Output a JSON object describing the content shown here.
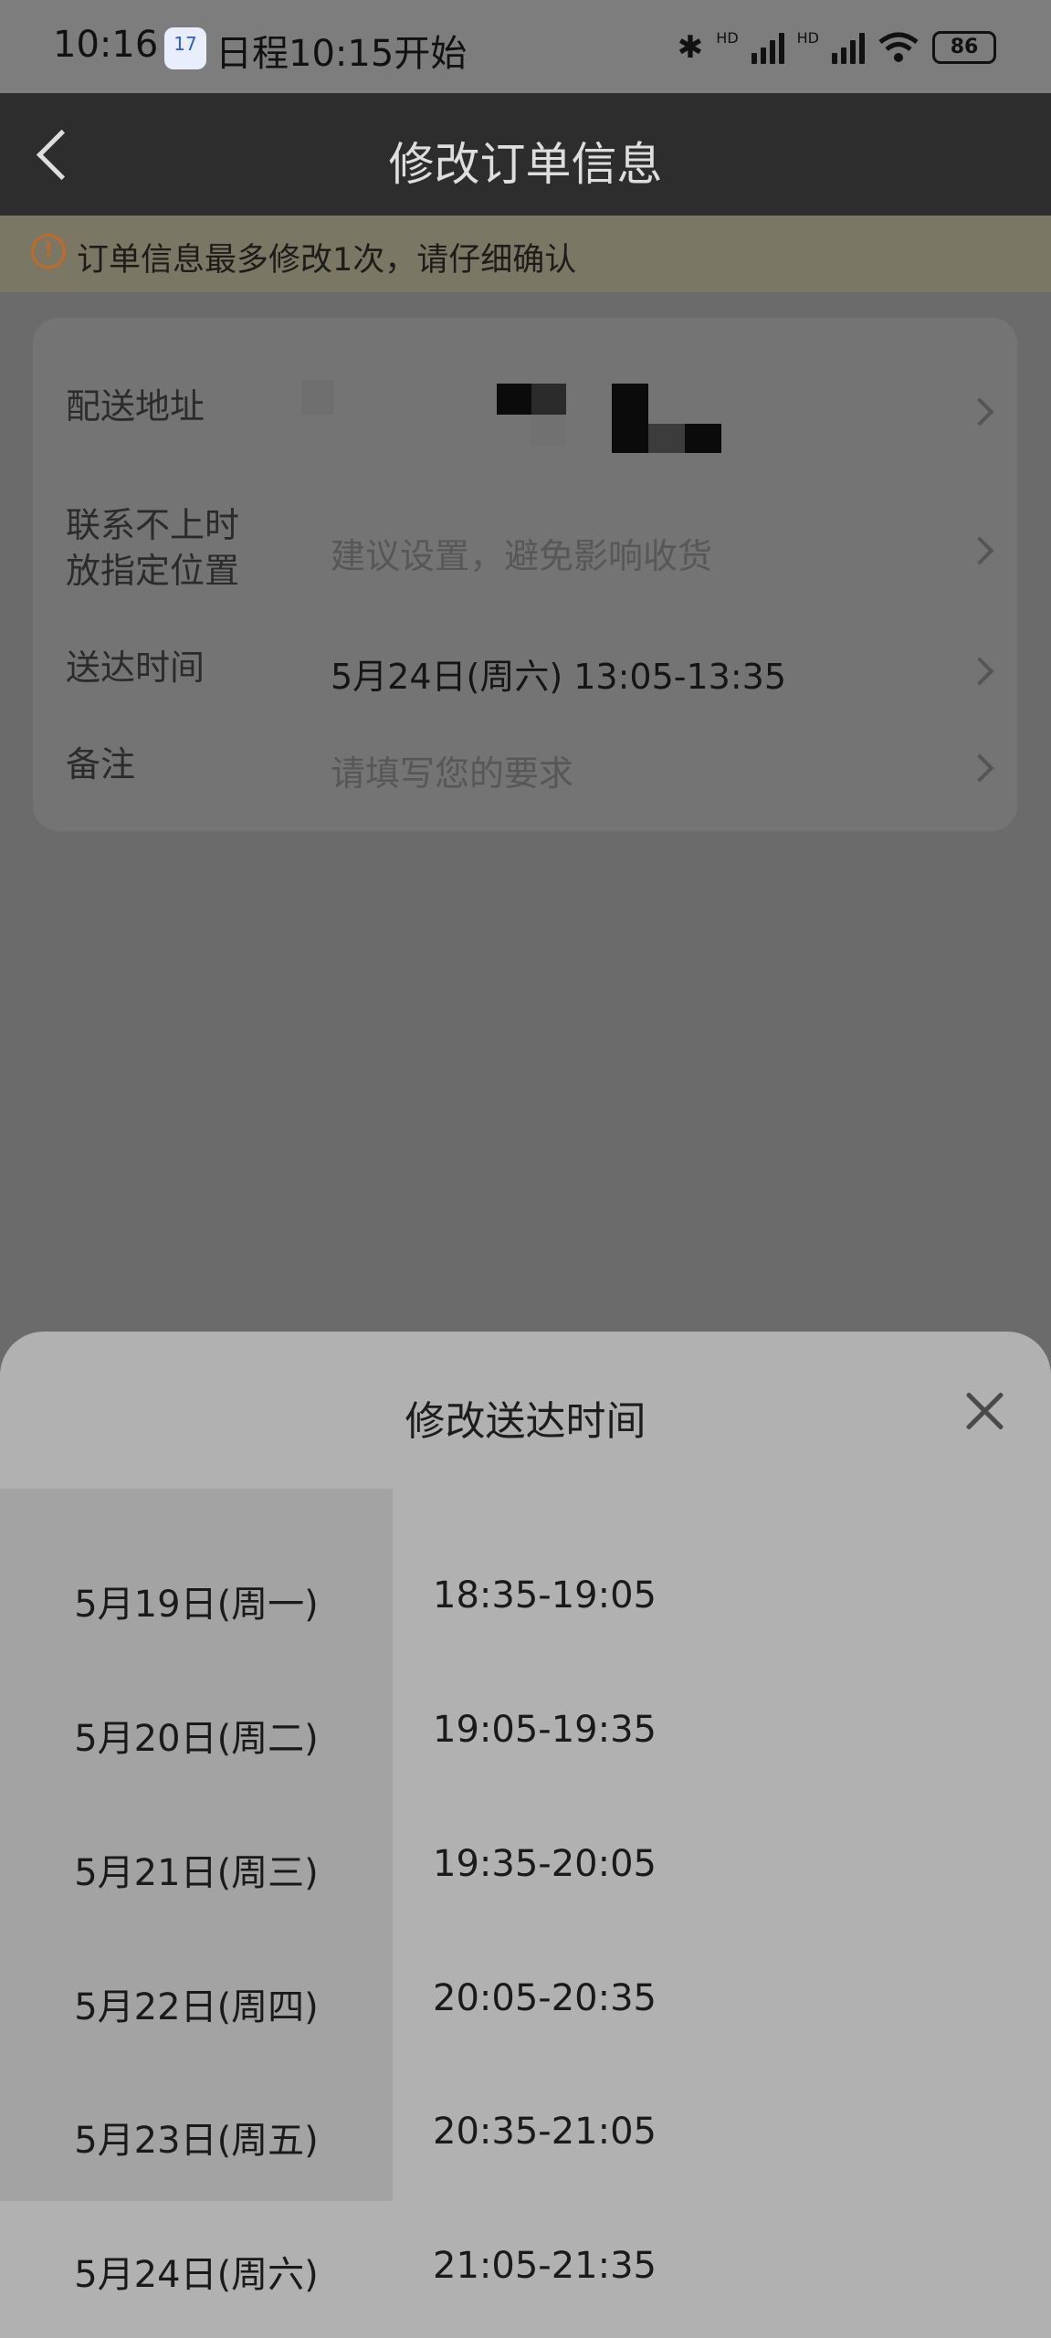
{
  "status_bar": {
    "time": "10:16",
    "calendar_icon_text": "17",
    "event": "日程10:15开始",
    "network_label_1": "HD",
    "network_label_2": "HD",
    "battery": "86"
  },
  "header": {
    "title": "修改订单信息"
  },
  "notice": {
    "icon": "!",
    "text": "订单信息最多修改1次，请仔细确认"
  },
  "order_info": {
    "address_label": "配送地址",
    "fallback_label_line1": "联系不上时",
    "fallback_label_line2": "放指定位置",
    "fallback_placeholder": "建议设置，避免影响收货",
    "time_label": "送达时间",
    "time_value": "5月24日(周六) 13:05-13:35",
    "remark_label": "备注",
    "remark_placeholder": "请填写您的要求"
  },
  "time_sheet": {
    "title": "修改送达时间",
    "dates": [
      "5月19日(周一)",
      "5月20日(周二)",
      "5月21日(周三)",
      "5月22日(周四)",
      "5月23日(周五)",
      "5月24日(周六)"
    ],
    "slots": [
      "18:35-19:05",
      "19:05-19:35",
      "19:35-20:05",
      "20:05-20:35",
      "20:35-21:05",
      "21:05-21:35"
    ]
  },
  "colors": {
    "overlay": "#6b6b6b",
    "header_bg": "#2d2d2d",
    "sheet_bg": "#b1b1b1",
    "warning": "#c26a23"
  }
}
